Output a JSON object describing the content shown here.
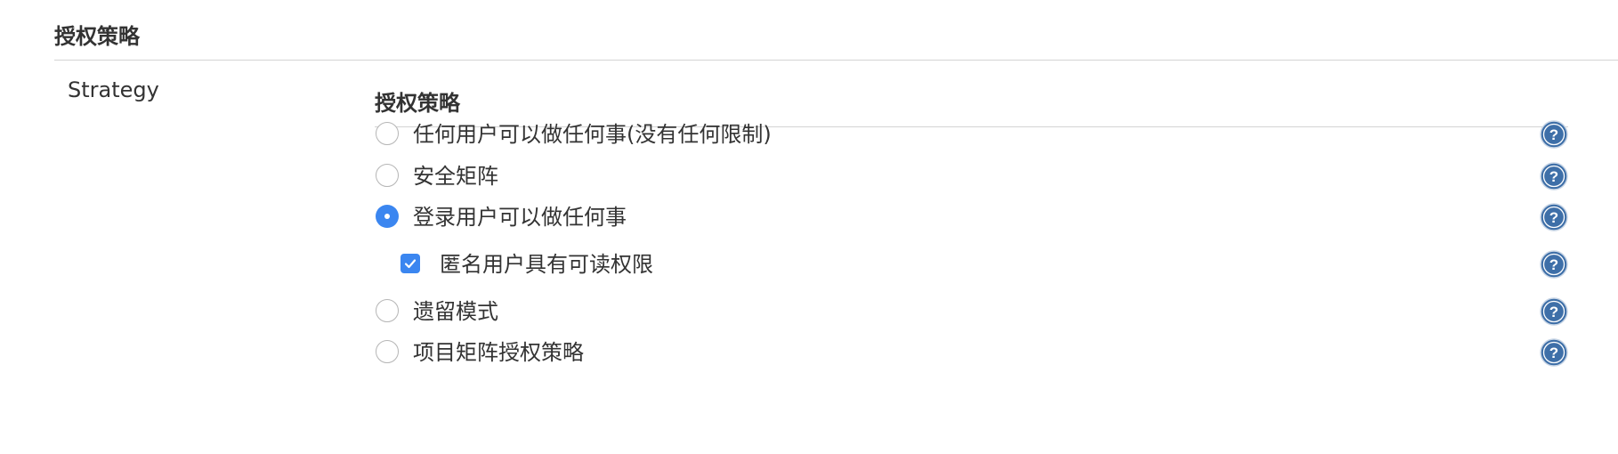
{
  "section": {
    "title": "授权策略"
  },
  "strategy": {
    "label": "Strategy",
    "subtitle": "授权策略",
    "options": [
      {
        "label": "任何用户可以做任何事(没有任何限制)",
        "selected": false
      },
      {
        "label": "安全矩阵",
        "selected": false
      },
      {
        "label": "登录用户可以做任何事",
        "selected": true
      },
      {
        "label": "遗留模式",
        "selected": false
      },
      {
        "label": "项目矩阵授权策略",
        "selected": false
      }
    ],
    "sub_option": {
      "label": "匿名用户具有可读权限",
      "checked": true
    }
  },
  "colors": {
    "accent": "#3b86f0",
    "help_icon": "#3e6fa8",
    "rule": "#d4d4d4",
    "text": "#333333"
  },
  "icons": {
    "help": "help-question-icon",
    "check": "checkmark-icon"
  }
}
